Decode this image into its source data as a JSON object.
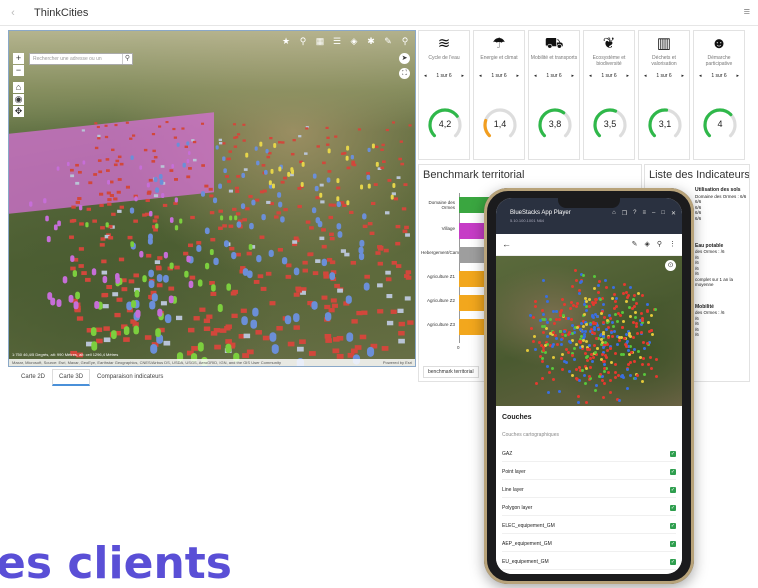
{
  "app": {
    "title": "ThinkCities",
    "back_icon": "chevron-left-icon",
    "menu_icon": "hamburger-icon"
  },
  "map": {
    "search_placeholder": "Rechercher une adresse ou un",
    "toolbar_icons": [
      "star-icon",
      "map-pin-icon",
      "grid-icon",
      "list-icon",
      "layers-icon",
      "settings-icon",
      "edit-icon",
      "search-icon"
    ],
    "footer_attribution": "Maxar, Microsoft, Source: Esri, Maxar, GeoEye, Earthstar Geographics, CNES/Airbus DS, USDA, USGS, AeroGRID, IGN, and the GIS User Community",
    "footer_powered": "Powered by Esri",
    "scale_text": "1:750 46,4/5 Degrés, alt: 990 Mètres, alt: cell 1296,4 Mètres"
  },
  "tabs": [
    "Carte 2D",
    "Carte 3D",
    "Comparaison indicateurs"
  ],
  "active_tab": "Carte 3D",
  "cards": [
    {
      "name": "Cycle de l'eau",
      "icon": "water-icon",
      "pager": "1 sur 6",
      "value": "4,2",
      "gauge": 0.7,
      "color": "#2fb84a"
    },
    {
      "name": "Énergie et climat",
      "icon": "weather-icon",
      "pager": "1 sur 6",
      "value": "1,4",
      "gauge": 0.23,
      "color": "#f29e1f"
    },
    {
      "name": "Mobilité et transports",
      "icon": "car-icon",
      "pager": "1 sur 6",
      "value": "3,8",
      "gauge": 0.63,
      "color": "#2fb84a"
    },
    {
      "name": "Écosystème et biodiversité",
      "icon": "leaf-icon",
      "pager": "1 sur 6",
      "value": "3,5",
      "gauge": 0.58,
      "color": "#2fb84a"
    },
    {
      "name": "Déchets et valorisation",
      "icon": "bin-icon",
      "pager": "1 sur 6",
      "value": "3,1",
      "gauge": 0.52,
      "color": "#2fb84a"
    },
    {
      "name": "Démarche participative",
      "icon": "people-icon",
      "pager": "1 sur 6",
      "value": "4",
      "gauge": 0.67,
      "color": "#2fb84a"
    }
  ],
  "benchmark": {
    "title": "Benchmark territorial",
    "tab": "benchmark territorial",
    "zero": "0",
    "categories": [
      "Domaine des Ormes",
      "Village",
      "Hebergement/Camping",
      "Agriculture Z1",
      "Agriculture Z2",
      "Agriculture Z3"
    ],
    "colors": [
      "#3aa640",
      "#c63cc6",
      "#9e9e9e",
      "#f2a71d",
      "#f2a71d",
      "#f2a71d"
    ]
  },
  "indicator_list": {
    "title": "Liste des Indicateurs",
    "sections": [
      {
        "heading": "Utilisation des sols",
        "lines": [
          "Domaine des Ormes : 6/6",
          "6/6",
          "6/6",
          "6/6",
          "6/6"
        ]
      },
      {
        "heading": "Eau potable",
        "lines": [
          "des Ormes : /6",
          "/6",
          "/6",
          "/6",
          "/6",
          "complet sur 1 an la moyenne"
        ]
      },
      {
        "heading": "Mobilité",
        "lines": [
          "des Ormes : /6",
          "/6",
          "/6",
          "/6",
          "/6"
        ]
      }
    ]
  },
  "headline": "es clients",
  "phone": {
    "bluestacks_title": "BlueStacks App Player",
    "bluestacks_sub": "5.10.100.1001 N64",
    "header_icons": [
      "home-icon",
      "windows-icon",
      "help-icon",
      "menu-icon",
      "minimize-icon",
      "maximize-icon",
      "close-icon"
    ],
    "app_tools": [
      "edit-icon",
      "layers-icon",
      "search-icon",
      "more-icon"
    ],
    "layers_title": "Couches",
    "layers_subtitle": "Couches cartographiques",
    "layers": [
      "GAZ",
      "Point layer",
      "Line layer",
      "Polygon layer",
      "ELEC_equipement_GM",
      "AEP_equipement_GM",
      "EU_equipement_GM"
    ]
  }
}
